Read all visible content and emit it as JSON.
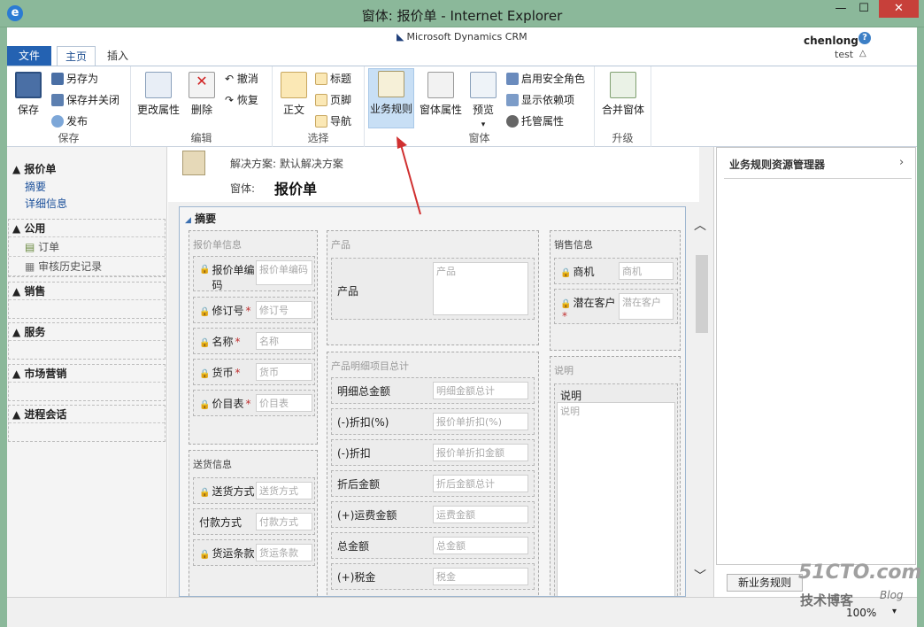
{
  "window": {
    "title": "窗体: 报价单 - Internet Explorer",
    "min": "—",
    "max": "☐",
    "close": "✕"
  },
  "crm": {
    "logo": "Microsoft Dynamics CRM",
    "user": "chenlong",
    "org": "test",
    "help": "?"
  },
  "tabs": {
    "file": "文件",
    "home": "主页",
    "insert": "插入"
  },
  "ribbon": {
    "save": {
      "group": "保存",
      "save_label": "保存",
      "save_as": "另存为",
      "save_close": "保存并关闭",
      "publish": "发布"
    },
    "edit": {
      "group": "编辑",
      "change_props": "更改属性",
      "delete": "删除",
      "undo": "撤消",
      "redo": "恢复"
    },
    "select": {
      "group": "选择",
      "body": "正文",
      "header": "标题",
      "footer": "页脚",
      "nav": "导航"
    },
    "form": {
      "group": "窗体",
      "biz_rules": "业务规则",
      "form_props": "窗体属性",
      "preview": "预览",
      "enable_security": "启用安全角色",
      "show_deps": "显示依赖项",
      "managed_props": "托管属性"
    },
    "upgrade": {
      "group": "升级",
      "merge": "合并窗体"
    }
  },
  "leftnav": {
    "title": "报价单",
    "sub": [
      "摘要",
      "详细信息"
    ],
    "sections": [
      {
        "header": "公用",
        "items": [
          "订单",
          "审核历史记录"
        ]
      },
      {
        "header": "销售",
        "items": []
      },
      {
        "header": "服务",
        "items": []
      },
      {
        "header": "市场营销",
        "items": []
      },
      {
        "header": "进程会话",
        "items": []
      }
    ]
  },
  "form": {
    "solution": "解决方案: 默认解决方案",
    "form_label": "窗体:",
    "form_name": "报价单",
    "tab_title": "摘要",
    "sections": {
      "quote_info": {
        "title": "报价单信息",
        "fields": [
          {
            "label": "报价单编码",
            "placeholder": "报价单编码"
          },
          {
            "label": "修订号",
            "placeholder": "修订号"
          },
          {
            "label": "名称",
            "placeholder": "名称"
          },
          {
            "label": "货币",
            "placeholder": "货币"
          },
          {
            "label": "价目表",
            "placeholder": "价目表"
          }
        ]
      },
      "shipping": {
        "title": "送货信息",
        "fields": [
          {
            "label": "送货方式",
            "placeholder": "送货方式"
          },
          {
            "label": "付款方式",
            "placeholder": "付款方式"
          },
          {
            "label": "货运条款",
            "placeholder": "货运条款"
          }
        ]
      },
      "products": {
        "title": "产品",
        "field_label": "产品",
        "field_placeholder": "产品"
      },
      "totals": {
        "title": "产品明细项目总计",
        "fields": [
          {
            "label": "明细总金额",
            "placeholder": "明细金额总计"
          },
          {
            "label": "(-)折扣(%)",
            "placeholder": "报价单折扣(%)"
          },
          {
            "label": "(-)折扣",
            "placeholder": "报价单折扣金额"
          },
          {
            "label": "折后金额",
            "placeholder": "折后金额总计"
          },
          {
            "label": "(+)运费金额",
            "placeholder": "运费金额"
          },
          {
            "label": "总金额",
            "placeholder": "总金额"
          },
          {
            "label": "(+)税金",
            "placeholder": "税金"
          }
        ]
      },
      "sales": {
        "title": "销售信息",
        "fields": [
          {
            "label": "商机",
            "placeholder": "商机"
          },
          {
            "label": "潜在客户",
            "placeholder": "潜在客户"
          }
        ]
      },
      "description": {
        "title": "说明",
        "field_label": "说明",
        "field_placeholder": "说明"
      }
    }
  },
  "rightpanel": {
    "title": "业务规则资源管理器",
    "new_button": "新业务规则"
  },
  "status": {
    "zoom": "100%"
  },
  "watermark": {
    "line1": "51CTO.com",
    "line2": "技术博客",
    "line3": "Blog"
  },
  "colors": {
    "accent": "#2462b2",
    "titlebar": "#8bb89a",
    "arrow": "#d03030"
  }
}
